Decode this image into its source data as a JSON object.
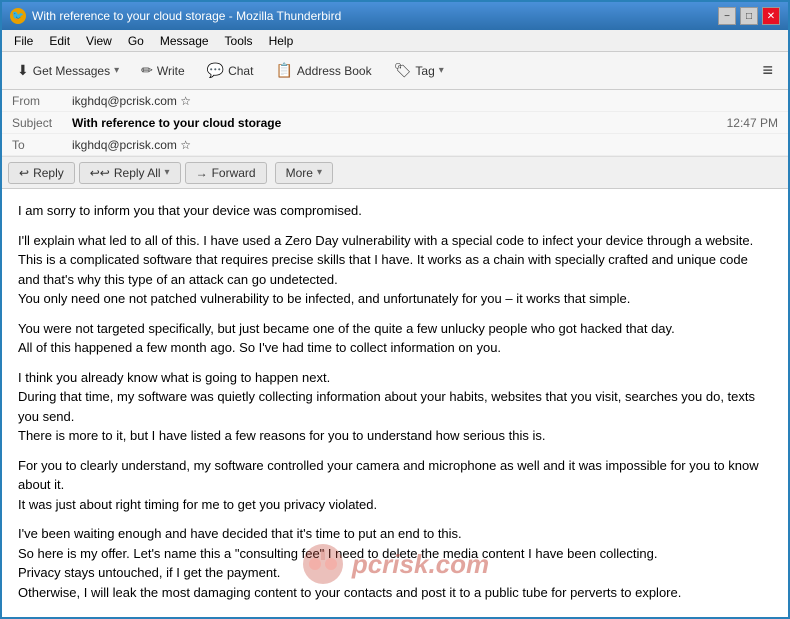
{
  "window": {
    "title": "With reference to your cloud storage - Mozilla Thunderbird",
    "icon": "🦤"
  },
  "window_controls": {
    "minimize": "−",
    "maximize": "□",
    "close": "✕"
  },
  "menu": {
    "items": [
      "File",
      "Edit",
      "View",
      "Go",
      "Message",
      "Tools",
      "Help"
    ]
  },
  "toolbar": {
    "get_messages_label": "Get Messages",
    "write_label": "Write",
    "chat_label": "Chat",
    "address_book_label": "Address Book",
    "tag_label": "Tag",
    "hamburger": "≡"
  },
  "email_header": {
    "from_label": "From",
    "from_value": "ikghdq@pcrisk.com ☆",
    "subject_label": "Subject",
    "subject_value": "With reference to your cloud storage",
    "timestamp": "12:47 PM",
    "to_label": "To",
    "to_value": "ikghdq@pcrisk.com ☆"
  },
  "actions": {
    "reply_label": "Reply",
    "reply_all_label": "Reply All",
    "forward_label": "Forward",
    "more_label": "More"
  },
  "email_body": {
    "paragraphs": [
      "I am sorry to inform you that your device was compromised.",
      "I'll explain what led to all of this. I have used a Zero Day vulnerability with a special code to infect your device through a website.\nThis is a complicated software that requires precise skills that I have. It works as a chain with specially crafted and unique code and that's why this type of an attack can go undetected.\nYou only need one not patched vulnerability to be infected, and unfortunately for you – it works that simple.",
      "You were not targeted specifically, but just became one of the quite a few unlucky people who got hacked that day.\nAll of this happened a few month ago. So I've had time to collect information on you.",
      "I think you already know what is going to happen next.\nDuring that time, my software was quietly collecting information about your habits, websites that you visit, searches you do, texts you send.\nThere is more to it, but I have listed a few reasons for you to understand how serious this is.",
      "For you to clearly understand, my software controlled your camera and microphone as well and it was impossible for you to know about it.\nIt was just about right timing for me to get you privacy violated.",
      "I've been waiting enough and have decided that it's time to put an end to this.\nSo here is my offer. Let's name this a \"consulting fee\" I need to delete the media content I have been collecting.\nPrivacy stays untouched, if I get the payment.\nOtherwise, I will leak the most damaging content to your contacts and post it to a public tube for perverts to explore."
    ]
  },
  "watermark": {
    "text": "pcrisk.com"
  },
  "colors": {
    "titlebar_start": "#4a90d9",
    "titlebar_end": "#2c6fad",
    "accent": "#2980b9",
    "action_reply": "#f0f0f0"
  }
}
